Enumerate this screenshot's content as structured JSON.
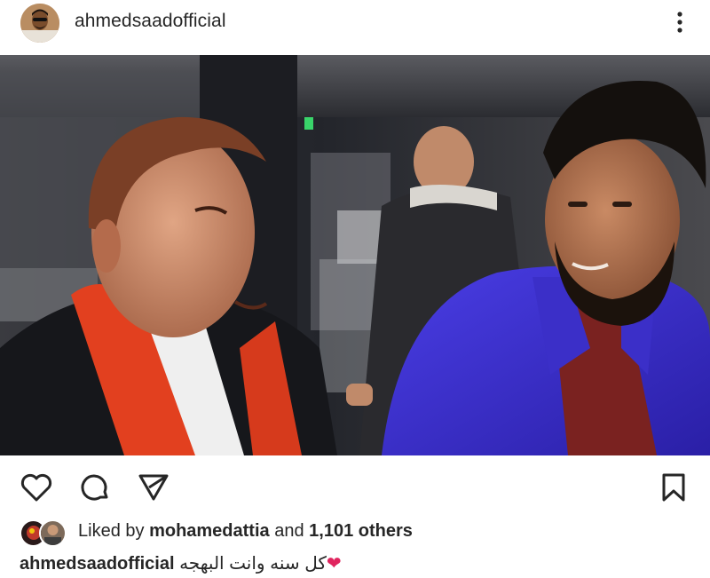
{
  "post": {
    "username": "ahmedsaadofficial",
    "menu_icon": "more-vertical-icon"
  },
  "actions": {
    "like_icon": "heart-icon",
    "comment_icon": "comment-icon",
    "share_icon": "send-icon",
    "save_icon": "bookmark-icon"
  },
  "likes": {
    "prefix": "Liked by",
    "user": "mohamedattia",
    "joiner": "and",
    "count": "1,101 others"
  },
  "caption": {
    "username": "ahmedsaadofficial",
    "text": "كل سنه وانت البهجه",
    "emoji": "❤"
  },
  "colors": {
    "text": "#262626",
    "heart": "#e0245e",
    "jacket_blue": "#3a2fd0",
    "scarf_red": "#e2401f"
  }
}
